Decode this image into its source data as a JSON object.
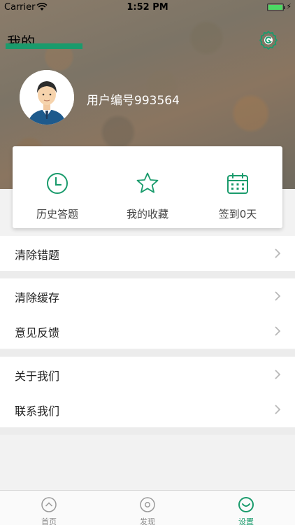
{
  "status_bar": {
    "carrier": "Carrier",
    "time": "1:52 PM"
  },
  "header": {
    "title": "我的"
  },
  "profile": {
    "user_id": "用户编号993564"
  },
  "stats": [
    {
      "label": "历史答题",
      "icon": "clock-icon"
    },
    {
      "label": "我的收藏",
      "icon": "star-icon"
    },
    {
      "label": "签到0天",
      "icon": "calendar-icon"
    }
  ],
  "menu": {
    "group1": [
      {
        "label": "清除错题"
      }
    ],
    "group2": [
      {
        "label": "清除缓存"
      },
      {
        "label": "意见反馈"
      }
    ],
    "group3": [
      {
        "label": "关于我们"
      },
      {
        "label": "联系我们"
      }
    ]
  },
  "tabbar": [
    {
      "label": "首页",
      "icon": "home-icon"
    },
    {
      "label": "发现",
      "icon": "discover-icon"
    },
    {
      "label": "设置",
      "icon": "settings-icon",
      "active": true
    }
  ],
  "colors": {
    "accent": "#1a9b6c",
    "background": "#f2f2f2"
  }
}
